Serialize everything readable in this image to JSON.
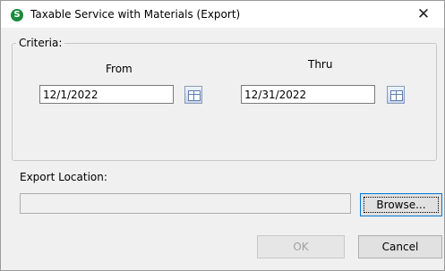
{
  "window": {
    "title": "Taxable Service with Materials (Export)",
    "app_icon_letter": "S",
    "close_glyph": "✕"
  },
  "criteria": {
    "legend": "Criteria:",
    "from_label": "From",
    "thru_label": "Thru",
    "from_value": "12/1/2022",
    "thru_value": "12/31/2022"
  },
  "export": {
    "label": "Export Location:",
    "value": "",
    "browse_label": "Browse..."
  },
  "buttons": {
    "ok_label": "OK",
    "cancel_label": "Cancel"
  },
  "colors": {
    "app_icon": "#1a8a3c",
    "focus_border": "#0078d7"
  }
}
